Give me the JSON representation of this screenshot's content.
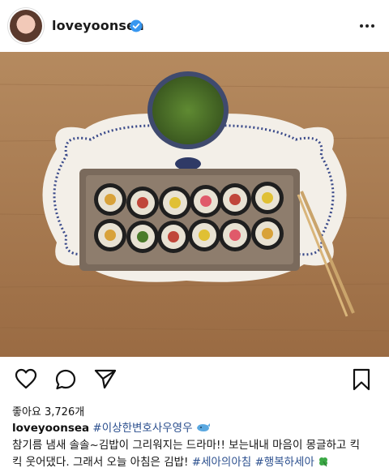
{
  "post": {
    "username": "loveyoonsea",
    "verified_icon": "verified-badge-icon",
    "more_icon": "more-dots-icon",
    "likes_label": "좋아요 3,726개",
    "caption": {
      "username": "loveyoonsea",
      "tag1": "#이상한변호사우영우",
      "whale_icon": "whale-emoji",
      "line1": "참기름 냄새 솔솔~김밥이 그리워지는 드라마!! 보는내내 마음이 몽글하고 킥",
      "line2a": "킥 웃어댔다. 그래서 오늘 아침은 김밥!",
      "tag2": "#세아의아침",
      "tag3": "#행복하세아",
      "clover_icon": "four-leaf-clover-emoji"
    }
  },
  "actions": {
    "like_icon": "heart-icon",
    "comment_icon": "comment-icon",
    "share_icon": "send-icon",
    "save_icon": "bookmark-icon"
  },
  "colors": {
    "accent_blue": "#2b4f8e",
    "verified_blue": "#3897f0"
  }
}
